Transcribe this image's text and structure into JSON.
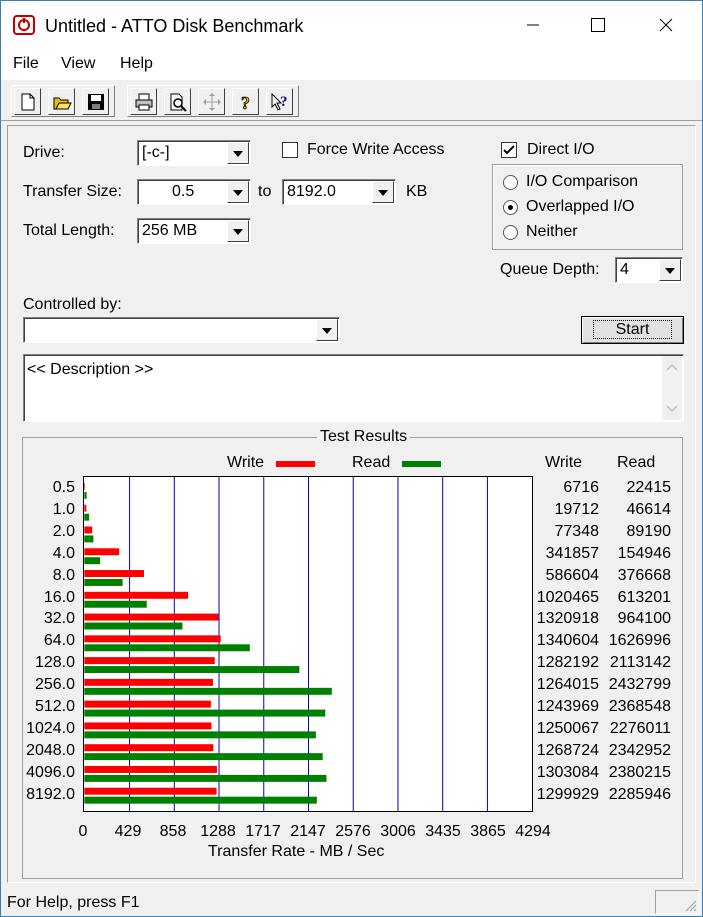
{
  "window": {
    "title": "Untitled - ATTO Disk Benchmark"
  },
  "menu": [
    "File",
    "View",
    "Help"
  ],
  "toolbar": {
    "icons": [
      "new-icon",
      "open-icon",
      "save-icon",
      "print-icon",
      "print-preview-icon",
      "move-icon",
      "help-icon",
      "context-help-icon"
    ]
  },
  "settings": {
    "drive_label": "Drive:",
    "drive_value": "[-c-]",
    "force_write_label": "Force Write Access",
    "force_write_checked": false,
    "direct_io_label": "Direct I/O",
    "direct_io_checked": true,
    "transfer_size_label": "Transfer Size:",
    "transfer_from": "0.5",
    "to_label": "to",
    "transfer_to": "8192.0",
    "kb_label": "KB",
    "total_length_label": "Total Length:",
    "total_length_value": "256 MB",
    "io_options": [
      {
        "label": "I/O Comparison",
        "selected": false
      },
      {
        "label": "Overlapped I/O",
        "selected": true
      },
      {
        "label": "Neither",
        "selected": false
      }
    ],
    "queue_depth_label": "Queue Depth:",
    "queue_depth_value": "4",
    "controlled_by_label": "Controlled by:",
    "controlled_by_value": "",
    "start_label": "Start",
    "description": "<< Description >>"
  },
  "results": {
    "title": "Test Results",
    "write_label": "Write",
    "read_label": "Read",
    "write_col": "Write",
    "read_col": "Read",
    "write_color": "#ff0000",
    "read_color": "#008000"
  },
  "chart_data": {
    "type": "bar",
    "orientation": "horizontal",
    "xlabel": "Transfer Rate - MB / Sec",
    "xlim": [
      0,
      4294
    ],
    "x_ticks": [
      "0",
      "429",
      "858",
      "1288",
      "1717",
      "2147",
      "2576",
      "3006",
      "3435",
      "3865",
      "4294"
    ],
    "categories": [
      "0.5",
      "1.0",
      "2.0",
      "4.0",
      "8.0",
      "16.0",
      "32.0",
      "64.0",
      "128.0",
      "256.0",
      "512.0",
      "1024.0",
      "2048.0",
      "4096.0",
      "8192.0"
    ],
    "series": [
      {
        "name": "Write",
        "color": "#ff0000",
        "values": [
          6716,
          19712,
          77348,
          341857,
          586604,
          1020465,
          1320918,
          1340604,
          1282192,
          1264015,
          1243969,
          1250067,
          1268724,
          1303084,
          1299929
        ]
      },
      {
        "name": "Read",
        "color": "#008000",
        "values": [
          22415,
          46614,
          89190,
          154946,
          376668,
          613201,
          964100,
          1626996,
          2113142,
          2432799,
          2368548,
          2276011,
          2342952,
          2380215,
          2285946
        ]
      }
    ],
    "grid": true,
    "legend": "top"
  },
  "status": {
    "text": "For Help, press F1"
  }
}
